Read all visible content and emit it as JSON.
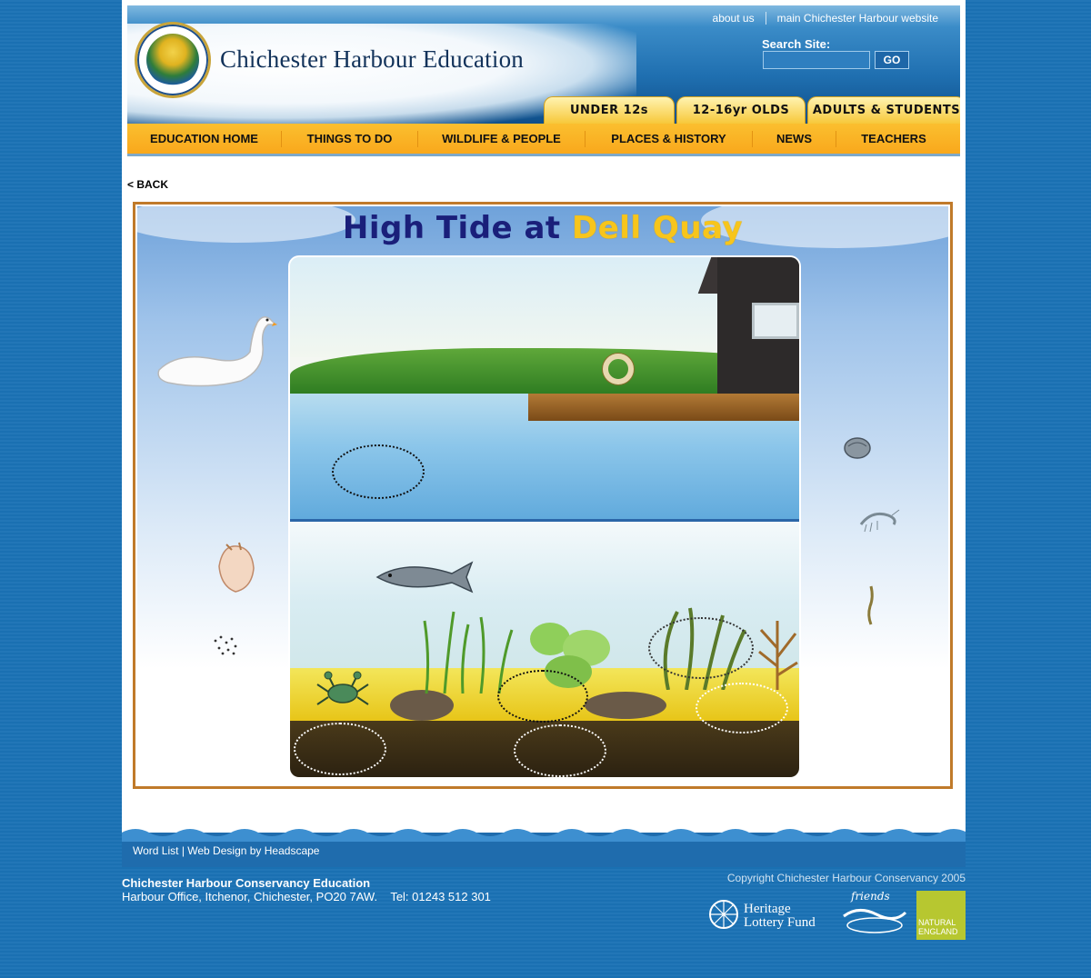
{
  "top_links": [
    "about us",
    "main Chichester Harbour website"
  ],
  "site_title": "Chichester Harbour Education",
  "search": {
    "label": "Search Site:",
    "value": "",
    "button": "GO"
  },
  "age_tabs": [
    "UNDER 12s",
    "12-16yr OLDS",
    "ADULTS & STUDENTS"
  ],
  "nav": [
    "EDUCATION HOME",
    "THINGS TO DO",
    "WILDLIFE & PEOPLE",
    "PLACES & HISTORY",
    "NEWS",
    "TEACHERS"
  ],
  "back_label": "< BACK",
  "game": {
    "title_part1": "High Tide at",
    "title_part2": "Dell Quay"
  },
  "footer": {
    "links": [
      "Word List",
      "Web Design by Headscape"
    ],
    "org_name": "Chichester Harbour Conservancy Education",
    "org_address": "Harbour Office, Itchenor, Chichester, PO20 7AW.",
    "org_tel": "Tel: 01243 512 301",
    "copyright": "Copyright Chichester Harbour Conservancy 2005",
    "partner_heritage_1": "Heritage",
    "partner_heritage_2": "Lottery Fund",
    "partner_friends": "friends",
    "partner_ne_1": "NATURAL",
    "partner_ne_2": "ENGLAND"
  },
  "colors": {
    "nav_bg": "#f9a81c",
    "title_blue": "#1a1f7a",
    "title_yellow": "#f7c51c",
    "frame_border": "#c07a2a",
    "page_bg": "#1b72b5"
  }
}
